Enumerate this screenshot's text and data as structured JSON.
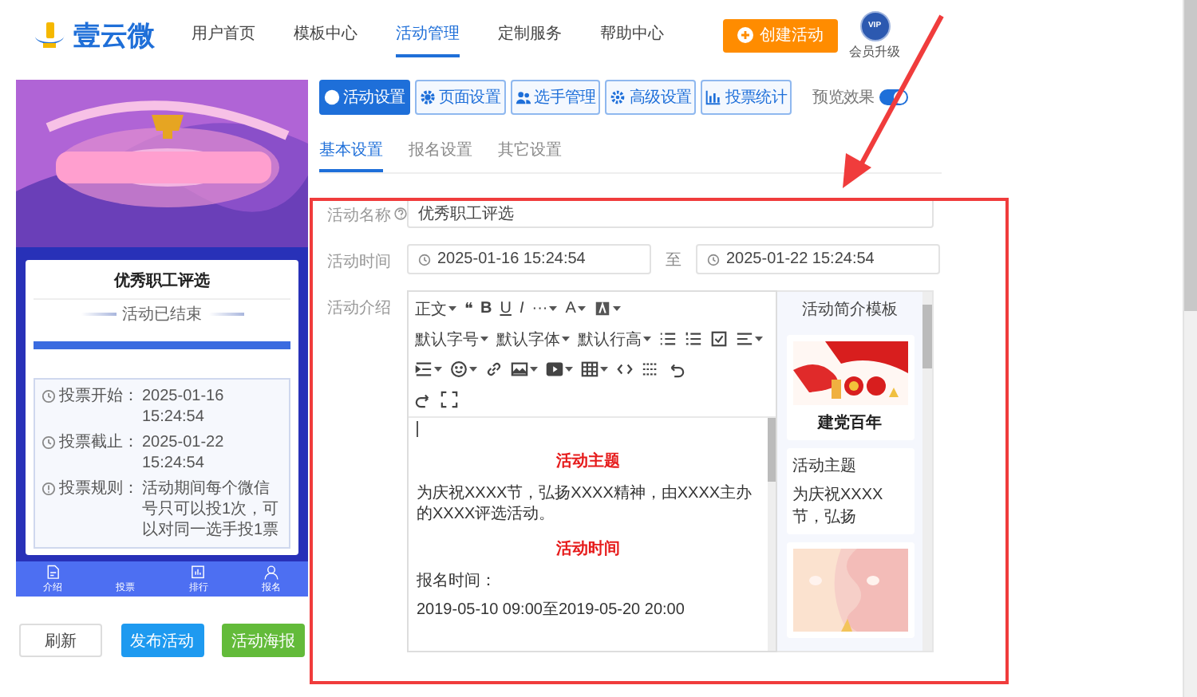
{
  "nav": {
    "brand": "壹云微",
    "items": [
      {
        "label": "用户首页",
        "selected": false
      },
      {
        "label": "模板中心",
        "selected": false
      },
      {
        "label": "活动管理",
        "selected": true
      },
      {
        "label": "定制服务",
        "selected": false
      },
      {
        "label": "帮助中心",
        "selected": false
      }
    ],
    "create_button": "创建活动",
    "vip_badge": "VIP",
    "upgrade_label": "会员升级"
  },
  "preview": {
    "card_title": "优秀职工评选",
    "status": "活动已结束",
    "progress": {
      "level": 1
    },
    "info": [
      {
        "label": "投票开始：",
        "value": "2025-01-16 15:24:54"
      },
      {
        "label": "投票截止：",
        "value": "2025-01-22 15:24:54"
      },
      {
        "label": "投票规则：",
        "value": "活动期间每个微信号只可以投1次，可以对同一选手投1票"
      }
    ],
    "tabbar": [
      {
        "label": "介绍",
        "icon": true
      },
      {
        "label": "投票",
        "icon": false
      },
      {
        "label": "排行",
        "icon": true
      },
      {
        "label": "报名",
        "icon": true
      }
    ],
    "actions": [
      {
        "label": "刷新",
        "kind": "plain"
      },
      {
        "label": "发布活动",
        "kind": "primary"
      },
      {
        "label": "活动海报",
        "kind": "success"
      }
    ]
  },
  "settings": {
    "tabs": [
      {
        "label": "活动设置",
        "selected": true
      },
      {
        "label": "页面设置",
        "selected": false
      },
      {
        "label": "选手管理",
        "selected": false
      },
      {
        "label": "高级设置",
        "selected": false
      },
      {
        "label": "投票统计",
        "selected": false
      }
    ],
    "preview_toggle": {
      "label": "预览效果",
      "on": true
    },
    "subtabs": [
      {
        "label": "基本设置",
        "selected": true
      },
      {
        "label": "报名设置",
        "selected": false
      },
      {
        "label": "其它设置",
        "selected": false
      }
    ],
    "form": {
      "name_label": "活动名称",
      "name_value": "优秀职工评选",
      "time_label": "活动时间",
      "start": "2025-01-16 15:24:54",
      "to": "至",
      "end": "2025-01-22 15:24:54",
      "intro_label": "活动介绍",
      "toolbar": [
        [
          {
            "kind": "text",
            "label": "正文",
            "dropdown": true
          },
          {
            "kind": "text",
            "label": "❝",
            "dropdown": false
          },
          {
            "kind": "bold",
            "label": "B",
            "dropdown": false
          },
          {
            "kind": "underline",
            "label": "U",
            "dropdown": false
          },
          {
            "kind": "italic",
            "label": "I",
            "dropdown": false
          },
          {
            "kind": "text",
            "label": "···",
            "dropdown": true
          },
          {
            "kind": "text",
            "label": "A",
            "dropdown": true
          },
          {
            "kind": "icon",
            "dropdown": true
          }
        ],
        [
          {
            "kind": "text",
            "label": "默认字号",
            "dropdown": true
          },
          {
            "kind": "text",
            "label": "默认字体",
            "dropdown": true
          },
          {
            "kind": "text",
            "label": "默认行高",
            "dropdown": true
          },
          {
            "kind": "icon",
            "dropdown": false
          },
          {
            "kind": "icon",
            "dropdown": false
          },
          {
            "kind": "icon",
            "dropdown": false
          },
          {
            "kind": "icon",
            "dropdown": true
          }
        ],
        [
          {
            "kind": "icon",
            "dropdown": true
          },
          {
            "kind": "icon",
            "dropdown": true
          },
          {
            "kind": "icon",
            "dropdown": false
          },
          {
            "kind": "icon",
            "dropdown": true
          },
          {
            "kind": "icon",
            "dropdown": true
          },
          {
            "kind": "icon",
            "dropdown": true
          },
          {
            "kind": "icon",
            "dropdown": false
          },
          {
            "kind": "icon",
            "dropdown": false
          },
          {
            "kind": "icon",
            "dropdown": false
          }
        ],
        [
          {
            "kind": "icon",
            "dropdown": false
          },
          {
            "kind": "icon",
            "dropdown": false
          }
        ]
      ],
      "content": [
        {
          "kind": "cursor"
        },
        {
          "kind": "heading",
          "text": "活动主题"
        },
        {
          "kind": "para",
          "text": "为庆祝XXXX节，弘扬XXXX精神，由XXXX主办的XXXX评选活动。"
        },
        {
          "kind": "heading",
          "text": "活动时间"
        },
        {
          "kind": "para",
          "text": "报名时间："
        },
        {
          "kind": "para",
          "text": "2019-05-10 09:00至2019-05-20 20:00"
        }
      ],
      "templates": {
        "title": "活动简介模板",
        "cards": [
          {
            "kind": "flag",
            "caption": "建党百年"
          },
          {
            "kind": "text",
            "heading": "活动主题",
            "caption": "为庆祝XXXX节，弘扬"
          },
          {
            "kind": "pink"
          }
        ]
      }
    }
  }
}
